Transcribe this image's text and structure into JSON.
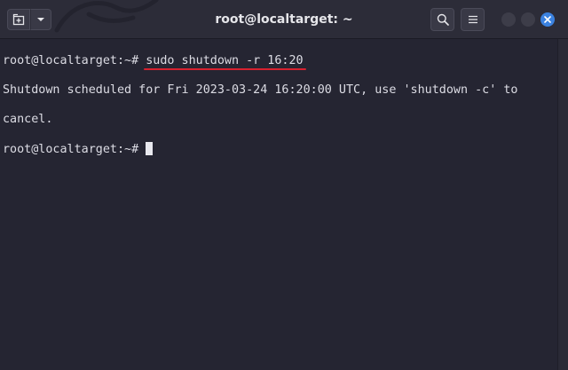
{
  "window": {
    "title": "root@localtarget: ~"
  },
  "toolbar": {
    "new_tab_icon": "new-tab-icon",
    "dropdown_icon": "chevron-down-icon",
    "search_icon": "search-icon",
    "menu_icon": "hamburger-menu-icon",
    "close_icon": "close-icon"
  },
  "terminal": {
    "prompt": "root@localtarget:~#",
    "command": "sudo shutdown -r 16:20",
    "output_line_1": "Shutdown scheduled for Fri 2023-03-24 16:20:00 UTC, use 'shutdown -c' to",
    "output_line_2": "cancel.",
    "prompt_2": "root@localtarget:~#"
  },
  "colors": {
    "background": "#252532",
    "titlebar": "#2c2c38",
    "text": "#dcdce4",
    "annotation_underline": "#d8212f",
    "close_button": "#3b82e0"
  }
}
